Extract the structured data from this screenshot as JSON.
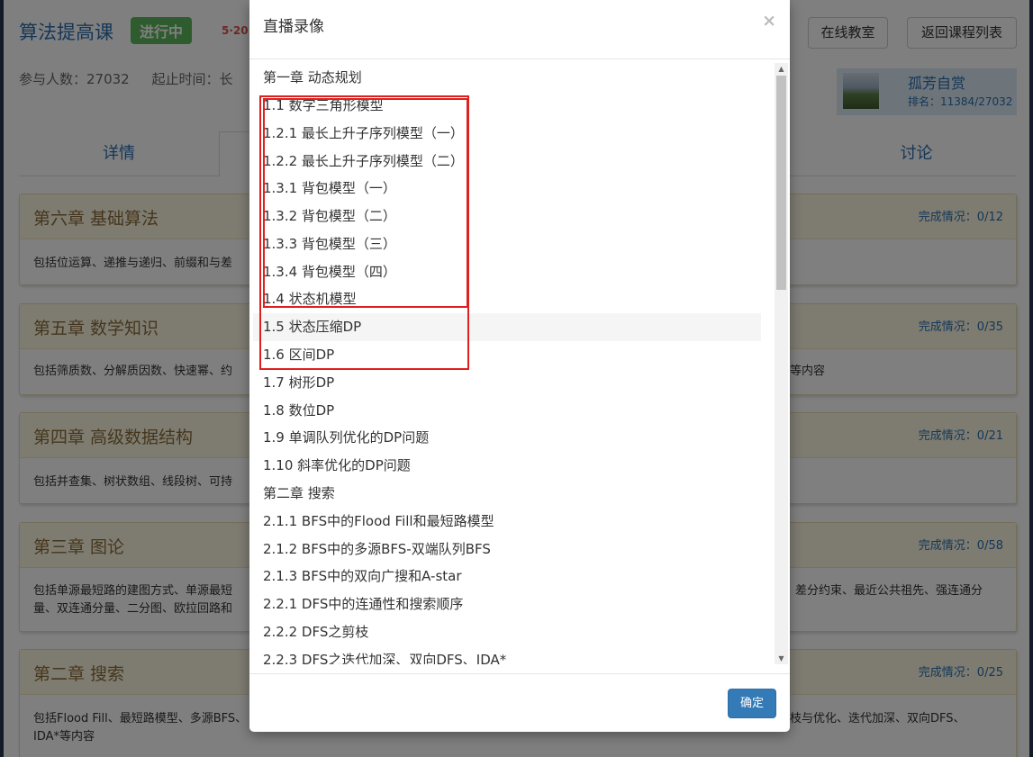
{
  "header": {
    "course_title": "算法提高课",
    "status": "进行中",
    "date_prefix": "5·20",
    "btn_online": "在线教室",
    "btn_back": "返回课程列表",
    "participants": "参与人数：27032",
    "period": "起止时间：长"
  },
  "user": {
    "name": "孤芳自赏",
    "rank": "排名：11384/27032"
  },
  "tabs": {
    "detail": "详情",
    "discuss": "讨论"
  },
  "chapters": [
    {
      "title": "第六章 基础算法",
      "progress": "完成情况：0/12",
      "desc_left": "包括位运算、递推与递归、前缀和与差",
      "desc_right": ""
    },
    {
      "title": "第五章 数学知识",
      "progress": "完成情况：0/35",
      "desc_left": "包括筛质数、分解质因数、快速幂、约",
      "desc_right": "等内容"
    },
    {
      "title": "第四章 高级数据结构",
      "progress": "完成情况：0/21",
      "desc_left": "包括并查集、树状数组、线段树、可持",
      "desc_right": ""
    },
    {
      "title": "第三章 图论",
      "progress": "完成情况：0/58",
      "desc_left": "包括单源最短路的建图方式、单源最短",
      "desc_left2": "量、双连通分量、二分图、欧拉回路和",
      "desc_right": "差分约束、最近公共祖先、强连通分",
      "desc_right2": ""
    },
    {
      "title": "第二章 搜索",
      "progress": "完成情况：0/25",
      "desc_left": "包括Flood Fill、最短路模型、多源BFS、",
      "desc_left2": "IDA*等内容",
      "desc_right": "枝与优化、迭代加深、双向DFS、"
    }
  ],
  "modal": {
    "title": "直播录像",
    "close": "×",
    "confirm": "确定",
    "items": [
      "第一章 动态规划",
      "1.1 数字三角形模型",
      "1.2.1 最长上升子序列模型（一）",
      "1.2.2 最长上升子序列模型（二）",
      "1.3.1 背包模型（一）",
      "1.3.2 背包模型（二）",
      "1.3.3 背包模型（三）",
      "1.3.4 背包模型（四）",
      "1.4 状态机模型",
      "1.5 状态压缩DP",
      "1.6 区间DP",
      "1.7 树形DP",
      "1.8 数位DP",
      "1.9 单调队列优化的DP问题",
      "1.10 斜率优化的DP问题",
      "第二章 搜索",
      "2.1.1 BFS中的Flood Fill和最短路模型",
      "2.1.2 BFS中的多源BFS-双端队列BFS",
      "2.1.3 BFS中的双向广搜和A-star",
      "2.2.1 DFS中的连通性和搜索顺序",
      "2.2.2 DFS之剪枝",
      "2.2.3 DFS之迭代加深、双向DFS、IDA*"
    ]
  },
  "colors": {
    "accent": "#2a6fb0",
    "highlight_box": "#e0201e",
    "confirm": "#337ab7",
    "status": "#5cb85c"
  }
}
